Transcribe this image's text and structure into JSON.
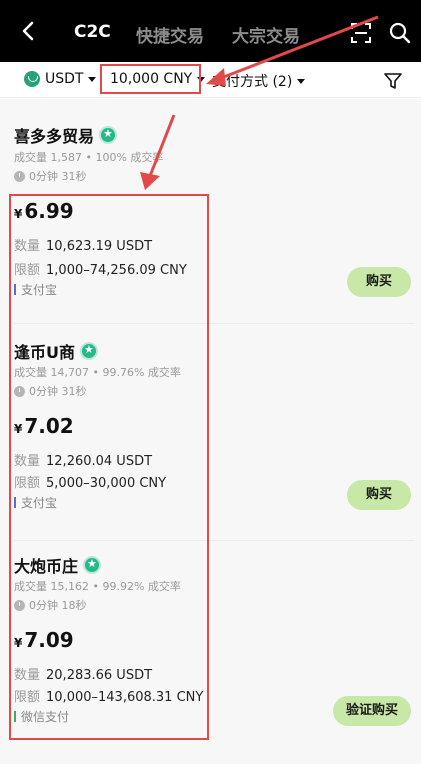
{
  "header": {
    "tabs": [
      {
        "label": "C2C",
        "active": true
      },
      {
        "label": "快捷交易",
        "active": false
      },
      {
        "label": "大宗交易",
        "active": false
      }
    ]
  },
  "filters": {
    "coin": "USDT",
    "amount": "10,000 CNY",
    "payment": "支付方式 (2)"
  },
  "offers": [
    {
      "merchant": "喜多多贸易",
      "stats": "成交量 1,587 • 100% 成交率",
      "time": "0分钟 31秒",
      "currency": "¥",
      "price": "6.99",
      "quantity_label": "数量",
      "quantity": "10,623.19 USDT",
      "limit_label": "限额",
      "limit": "1,000–74,256.09 CNY",
      "payment": "支付宝",
      "payment_color": "#5b6bd9",
      "button": "购买"
    },
    {
      "merchant": "逢币U商",
      "stats": "成交量 14,707 • 99.76% 成交率",
      "time": "0分钟 31秒",
      "currency": "¥",
      "price": "7.02",
      "quantity_label": "数量",
      "quantity": "12,260.04 USDT",
      "limit_label": "限额",
      "limit": "5,000–30,000 CNY",
      "payment": "支付宝",
      "payment_color": "#5b6bd9",
      "button": "购买"
    },
    {
      "merchant": "大炮币庄",
      "stats": "成交量 15,162 • 99.92% 成交率",
      "time": "0分钟 18秒",
      "currency": "¥",
      "price": "7.09",
      "quantity_label": "数量",
      "quantity": "20,283.66 USDT",
      "limit_label": "限额",
      "limit": "10,000–143,608.31 CNY",
      "payment": "微信支付",
      "payment_color": "#35b35a",
      "button": "验证购买"
    }
  ]
}
